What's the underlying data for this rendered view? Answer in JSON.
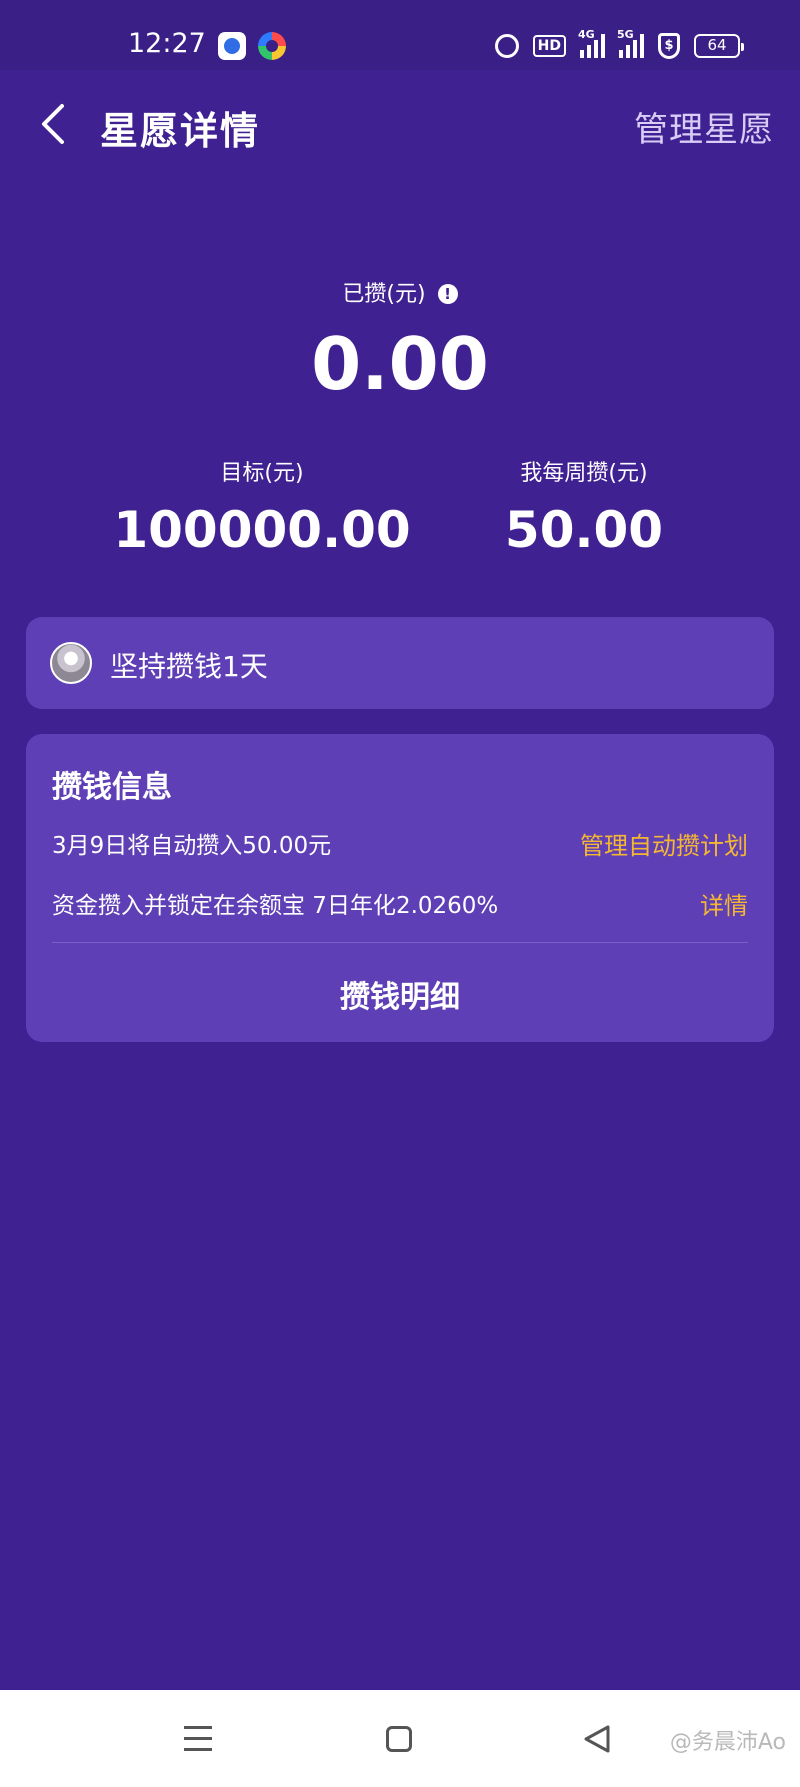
{
  "status_bar": {
    "time": "12:27",
    "hd_label": "HD",
    "net1_label": "4G",
    "net2_label": "5G",
    "shield_symbol": "$",
    "battery": "64",
    "icons": [
      "baidu-app-icon",
      "swirl-app-icon",
      "alarm-icon",
      "hd-icon",
      "signal-4g-icon",
      "signal-5g-icon",
      "shield-icon",
      "battery-icon"
    ]
  },
  "header": {
    "title": "星愿详情",
    "manage_label": "管理星愿"
  },
  "summary": {
    "saved_label": "已攒(元)",
    "saved_value": "0.00",
    "target_label": "目标(元)",
    "target_value": "100000.00",
    "weekly_label": "我每周攒(元)",
    "weekly_value": "50.00"
  },
  "streak": {
    "text": "坚持攒钱1天"
  },
  "saving_info": {
    "title": "攒钱信息",
    "auto_save_text": "3月9日将自动攒入50.00元",
    "auto_save_link": "管理自动攒计划",
    "lock_text": "资金攒入并锁定在余额宝 7日年化2.0260%",
    "lock_link": "详情",
    "detail_button": "攒钱明细"
  },
  "watermark": "@务晨沛Ao",
  "colors": {
    "background": "#402192",
    "card": "#5e3fb6",
    "accent_link": "#f5b731"
  }
}
